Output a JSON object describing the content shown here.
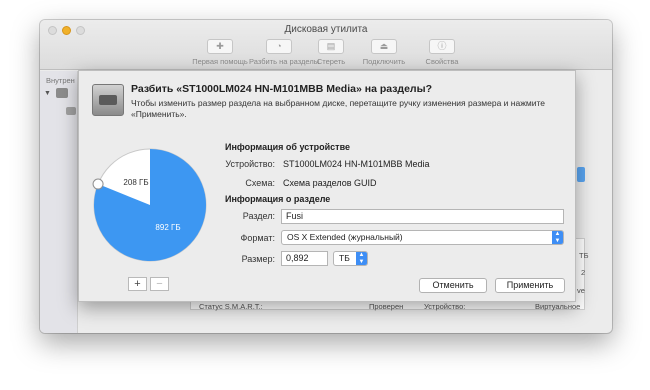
{
  "window": {
    "title": "Дисковая утилита",
    "toolbar": [
      {
        "label": "Первая помощь",
        "icon": "stethoscope-icon",
        "glyph": "✚"
      },
      {
        "label": "Разбить на разделы",
        "icon": "partition-icon",
        "glyph": "◔"
      },
      {
        "label": "Стереть",
        "icon": "erase-icon",
        "glyph": "▤"
      },
      {
        "label": "Подключить",
        "icon": "mount-icon",
        "glyph": "⏏"
      },
      {
        "label": "Свойства",
        "icon": "info-icon",
        "glyph": "ⓘ"
      }
    ],
    "sidebar": {
      "header": "Внутрен"
    },
    "background_cells": {
      "status_label": "Статус S.M.A.R.T.:",
      "status_value": "Проверен",
      "device_label": "Устройство:",
      "device_value": "Виртуальное",
      "cell_tb": "ТБ",
      "cell_two": "2",
      "cell_ve": "ve"
    }
  },
  "dialog": {
    "title": "Разбить «ST1000LM024 HN-M101MBB Media» на разделы?",
    "description": "Чтобы изменить размер раздела на выбранном диске, перетащите ручку изменения размера и нажмите «Применить».",
    "device_info": {
      "heading": "Информация об устройстве",
      "device_label": "Устройство:",
      "device_value": "ST1000LM024 HN-M101MBB Media",
      "scheme_label": "Схема:",
      "scheme_value": "Схема разделов GUID"
    },
    "partition_info": {
      "heading": "Информация о разделе",
      "name_label": "Раздел:",
      "name_value": "Fusi",
      "format_label": "Формат:",
      "format_value": "OS X Extended (журнальный)",
      "size_label": "Размер:",
      "size_value": "0,892",
      "unit_value": "ТБ"
    },
    "pie": {
      "free_label": "208 ГБ",
      "used_label": "892 ГБ",
      "used_fraction": 0.811,
      "used_color": "#3d97f2",
      "free_color": "#ffffff"
    },
    "buttons": {
      "add": "+",
      "remove": "−",
      "cancel": "Отменить",
      "apply": "Применить"
    }
  }
}
